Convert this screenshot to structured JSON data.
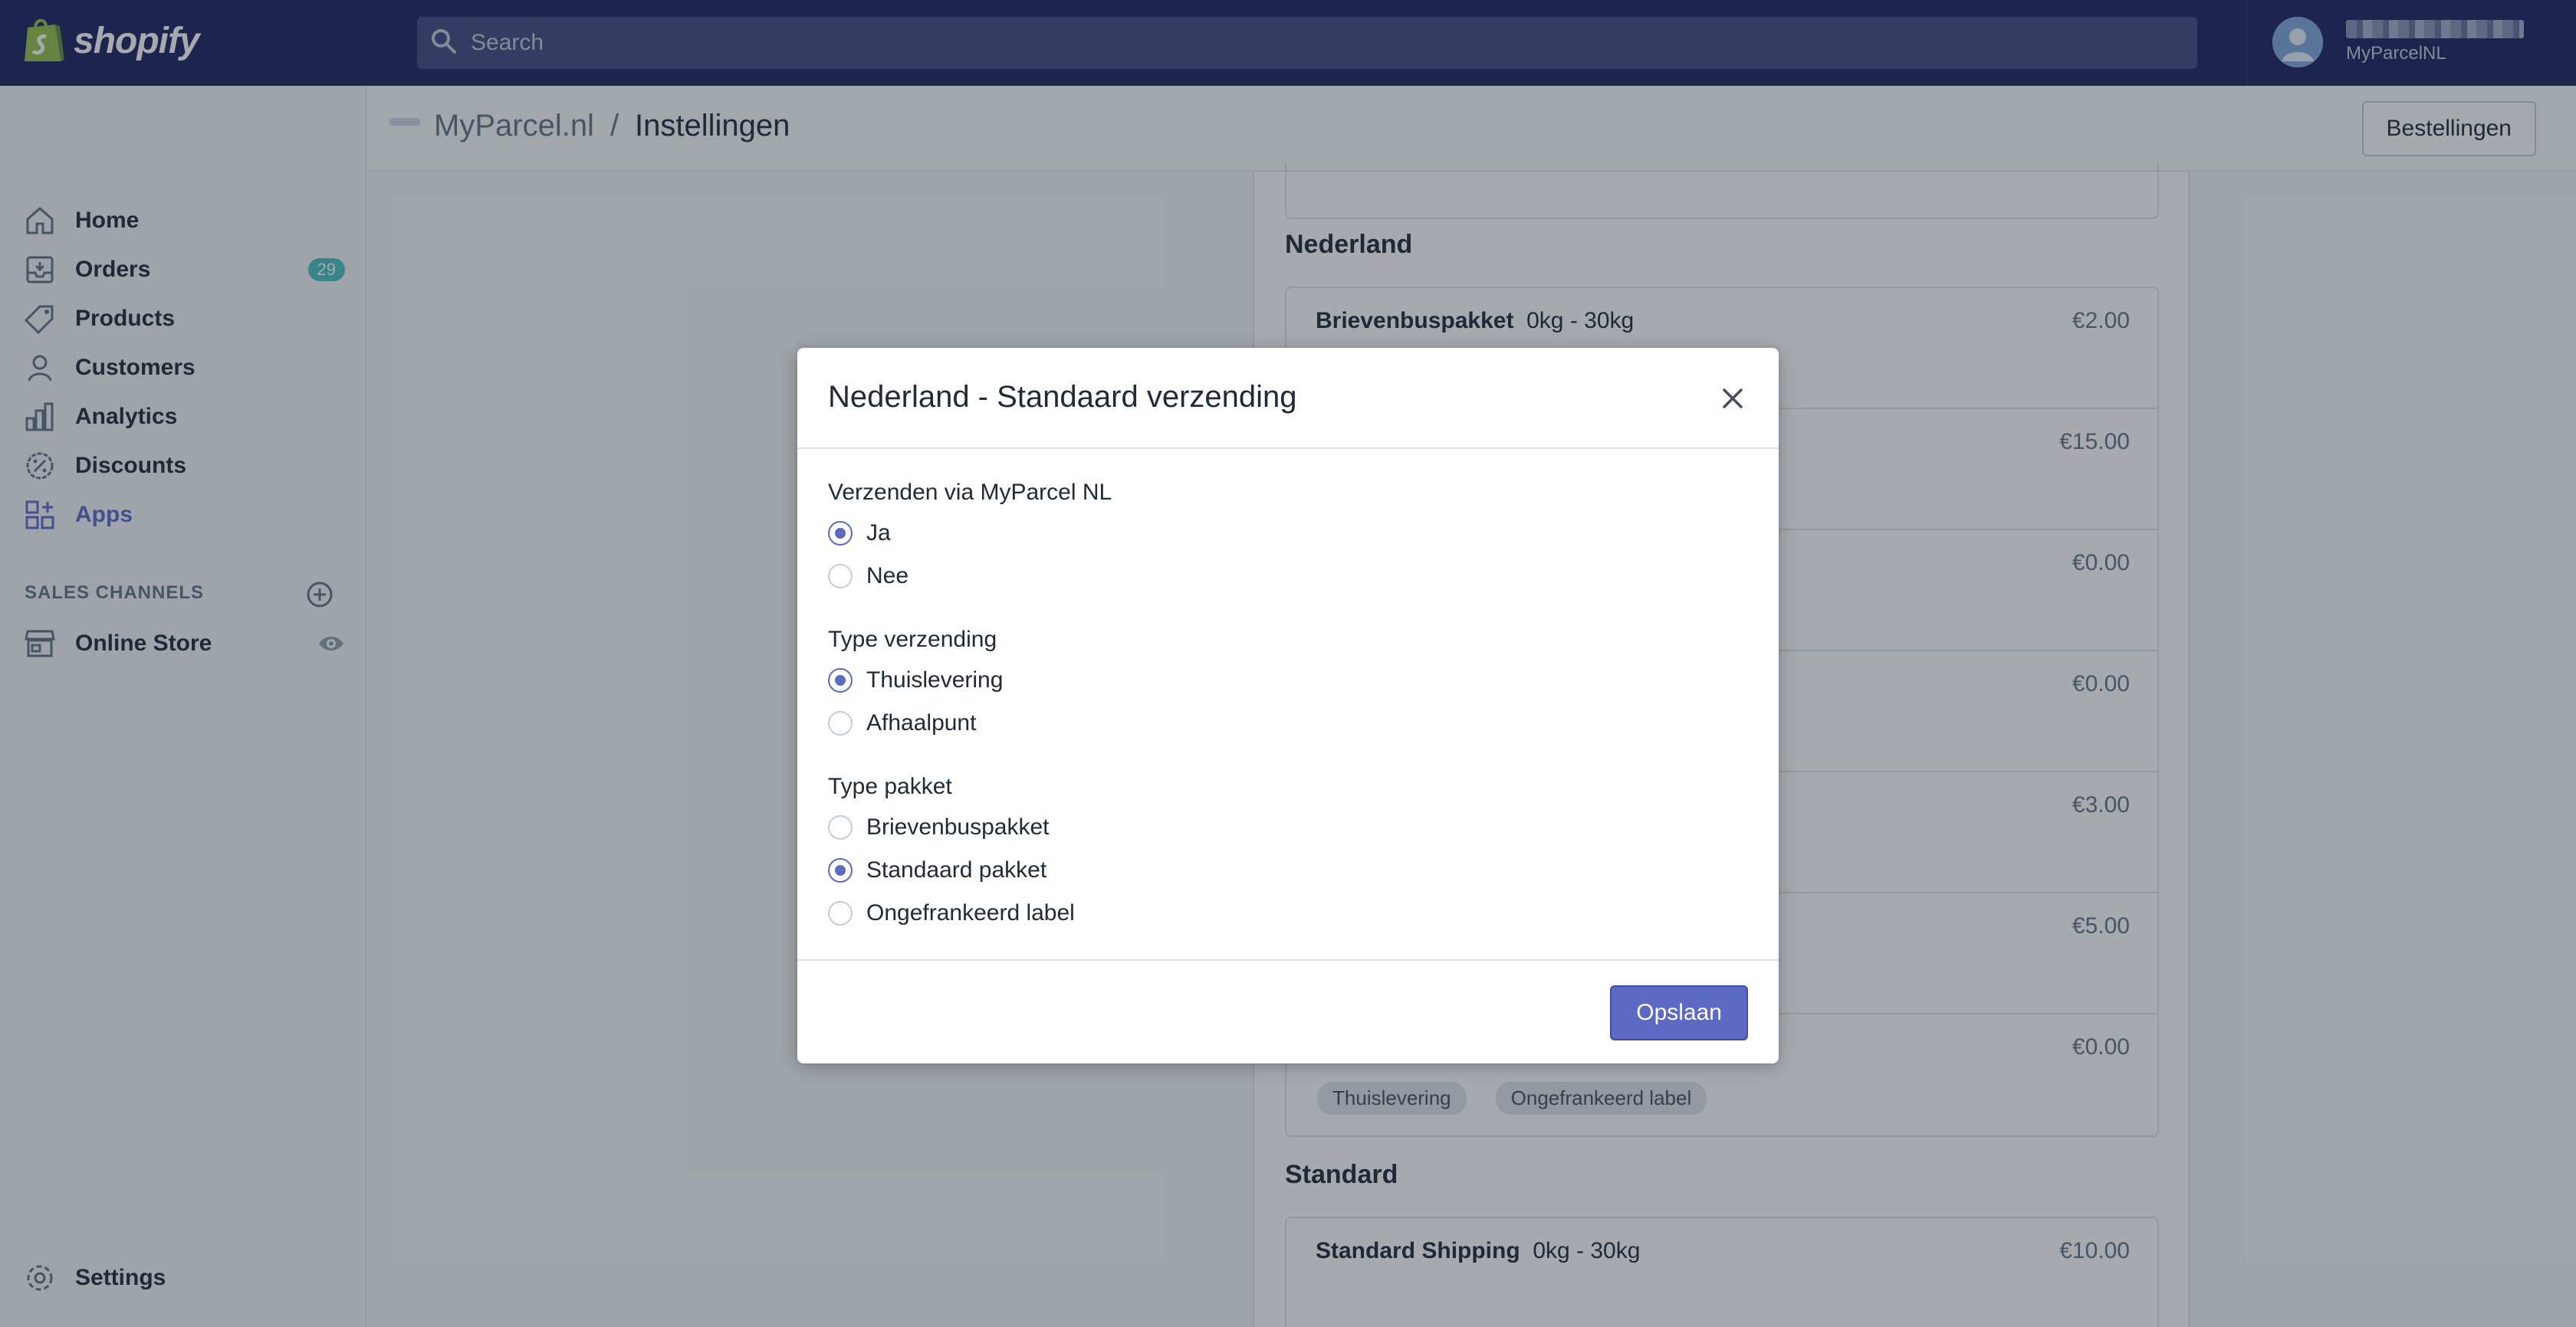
{
  "topbar": {
    "logo_text": "shopify",
    "search_placeholder": "Search",
    "user_shop": "MyParcelNL"
  },
  "sidebar": {
    "items": [
      {
        "label": "Home",
        "icon": "home-icon"
      },
      {
        "label": "Orders",
        "icon": "orders-icon",
        "badge": "29"
      },
      {
        "label": "Products",
        "icon": "tag-icon"
      },
      {
        "label": "Customers",
        "icon": "person-icon"
      },
      {
        "label": "Analytics",
        "icon": "bar-chart-icon"
      },
      {
        "label": "Discounts",
        "icon": "discount-icon"
      },
      {
        "label": "Apps",
        "icon": "apps-icon",
        "active": true
      }
    ],
    "sales_channels_title": "SALES CHANNELS",
    "online_store": "Online Store",
    "settings": "Settings"
  },
  "app_header": {
    "app_name": "MyParcel.nl",
    "separator": "/",
    "page": "Instellingen",
    "orders_button": "Bestellingen"
  },
  "main": {
    "section_nederland": "Nederland",
    "rates": [
      {
        "name": "Brievenbuspakket",
        "range": "0kg - 30kg",
        "price": "€2.00"
      },
      {
        "price": "€15.00"
      },
      {
        "price": "€0.00"
      },
      {
        "price": "€0.00"
      },
      {
        "price": "€3.00"
      },
      {
        "price": "€5.00"
      },
      {
        "price": "€0.00",
        "tags": [
          "Thuislevering",
          "Ongefrankeerd label"
        ]
      }
    ],
    "section_standard": "Standard",
    "standard_rate": {
      "name": "Standard Shipping",
      "range": "0kg - 30kg",
      "price": "€10.00"
    }
  },
  "modal": {
    "title": "Nederland - Standaard verzending",
    "groups": [
      {
        "title": "Verzenden via MyParcel NL",
        "options": [
          {
            "label": "Ja",
            "checked": true
          },
          {
            "label": "Nee",
            "checked": false
          }
        ]
      },
      {
        "title": "Type verzending",
        "options": [
          {
            "label": "Thuislevering",
            "checked": true
          },
          {
            "label": "Afhaalpunt",
            "checked": false
          }
        ]
      },
      {
        "title": "Type pakket",
        "options": [
          {
            "label": "Brievenbuspakket",
            "checked": false
          },
          {
            "label": "Standaard pakket",
            "checked": true
          },
          {
            "label": "Ongefrankeerd label",
            "checked": false
          }
        ]
      }
    ],
    "save_button": "Opslaan"
  },
  "colors": {
    "topbar": "#1c2260",
    "accent": "#5c6ac4",
    "badge": "#47c1bf"
  }
}
